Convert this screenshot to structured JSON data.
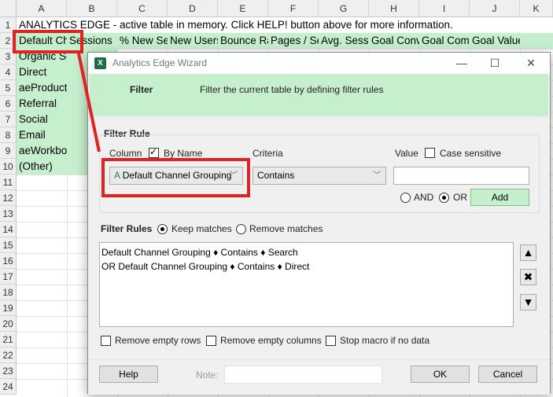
{
  "spreadsheet": {
    "columns": [
      "A",
      "B",
      "C",
      "D",
      "E",
      "F",
      "G",
      "H",
      "I",
      "J",
      "K"
    ],
    "rows": [
      "1",
      "2",
      "3",
      "4",
      "5",
      "6",
      "7",
      "8",
      "9",
      "10",
      "11",
      "12",
      "13",
      "14",
      "15",
      "16",
      "17",
      "18",
      "19",
      "20",
      "21",
      "22",
      "23",
      "24"
    ],
    "banner_text": "ANALYTICS EDGE - active table in memory. Click HELP! button above for more information.",
    "headers": [
      "Default Channel Grouping",
      "Sessions",
      "% New Sessions",
      "New Users",
      "Bounce Rate",
      "Pages / Session",
      "Avg. Session Duration",
      "Goal Conversion Rate",
      "Goal Completions",
      "Goal Value"
    ],
    "channels": [
      "Organic Search",
      "Direct",
      "aeProduct",
      "Referral",
      "Social",
      "Email",
      "aeWorkbook",
      "(Other)"
    ]
  },
  "dialog": {
    "title": "Analytics Edge Wizard",
    "window_buttons": {
      "minimize": "—",
      "maximize": "☐",
      "close": "✕"
    },
    "section": "Filter",
    "description": "Filter the current table by defining filter rules",
    "filter_rule": {
      "heading": "Filter Rule",
      "column_label": "Column",
      "by_name_label": "By Name",
      "by_name_checked": true,
      "column_prefix": "A",
      "column_value": "Default Channel Grouping",
      "criteria_label": "Criteria",
      "criteria_value": "Contains",
      "value_label": "Value",
      "case_sensitive_label": "Case sensitive",
      "value_input": "",
      "and_label": "AND",
      "or_label": "OR",
      "or_selected": true,
      "add_label": "Add"
    },
    "filter_rules": {
      "heading": "Filter Rules",
      "keep_label": "Keep matches",
      "remove_label": "Remove matches",
      "keep_selected": true,
      "rules": [
        "Default Channel Grouping ♦ Contains ♦ Search",
        "OR Default Channel Grouping ♦ Contains ♦ Direct"
      ]
    },
    "side_buttons": {
      "up": "▲",
      "delete": "✖",
      "down": "▼"
    },
    "options": {
      "remove_empty_rows": "Remove empty rows",
      "remove_empty_columns": "Remove empty columns",
      "stop_macro": "Stop macro if no data"
    },
    "footer": {
      "help": "Help",
      "note_label": "Note:",
      "note_value": "",
      "ok": "OK",
      "cancel": "Cancel"
    }
  },
  "colors": {
    "highlight_green": "#c6efce",
    "annotation_red": "#e02222",
    "excel_green": "#1d6f42"
  }
}
